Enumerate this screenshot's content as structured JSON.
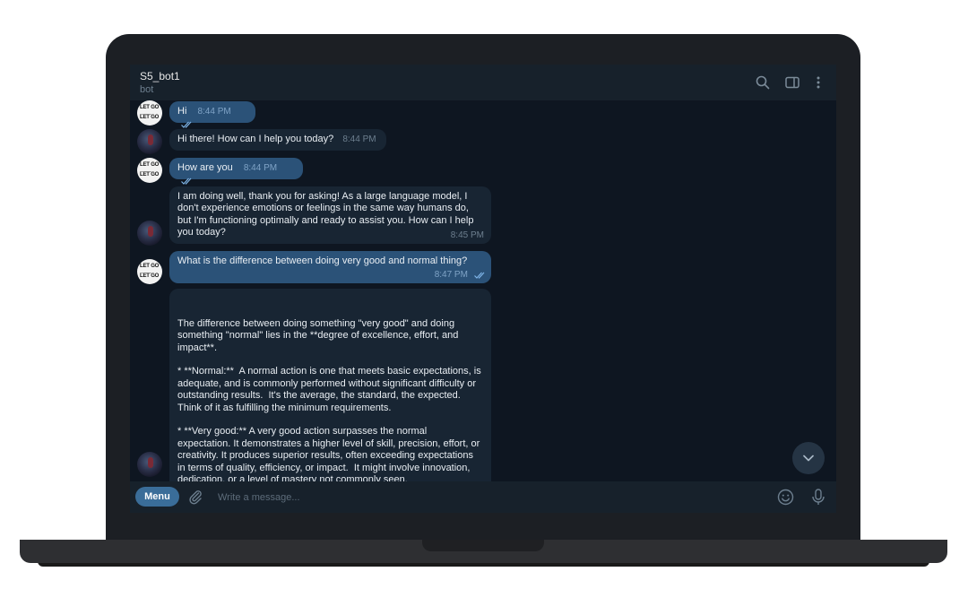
{
  "header": {
    "title": "S5_bot1",
    "subtitle": "bot",
    "icons": [
      "search-icon",
      "side-panel-icon",
      "more-vertical-icon"
    ]
  },
  "messages": [
    {
      "from": "user",
      "text": "Hi",
      "time": "8:44 PM"
    },
    {
      "from": "bot",
      "text": "Hi there! How can I help you today?",
      "time": "8:44 PM"
    },
    {
      "from": "user",
      "text": "How are you",
      "time": "8:44 PM"
    },
    {
      "from": "bot",
      "text": "I am doing well, thank you for asking!  As a large language model, I don't experience emotions or feelings in the same way humans do, but I'm functioning optimally and ready to assist you.  How can I help you today?",
      "time": "8:45 PM"
    },
    {
      "from": "user",
      "text": "What is the difference between doing very good and normal thing?",
      "time": "8:47 PM"
    },
    {
      "from": "bot",
      "text": "The difference between doing something \"very good\" and doing something \"normal\" lies in the **degree of excellence, effort, and impact**.\n\n* **Normal:**  A normal action is one that meets basic expectations, is adequate, and is commonly performed without significant difficulty or outstanding results.  It's the average, the standard, the expected.  Think of it as fulfilling the minimum requirements.\n\n* **Very good:** A very good action surpasses the normal expectation. It demonstrates a higher level of skill, precision, effort, or creativity. It produces superior results, often exceeding expectations in terms of quality, efficiency, or impact.  It might involve innovation, dedication, or a level of mastery not commonly seen.",
      "time": ""
    }
  ],
  "user_avatar_text": "LET GO\nLET GO",
  "composer": {
    "menu_label": "Menu",
    "placeholder": "Write a message..."
  },
  "colors": {
    "background": "#0e1621",
    "header": "#17212b",
    "outgoing_bubble": "#2b5278",
    "incoming_bubble": "#182533",
    "accent": "#3a6d99"
  }
}
